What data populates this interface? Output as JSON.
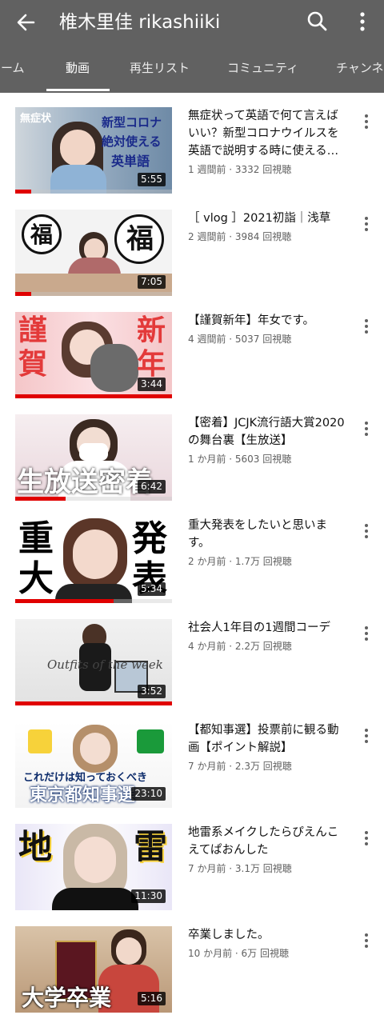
{
  "header": {
    "title": "椎木里佳 rikashiiki",
    "back_icon": "arrow-left-icon",
    "search_icon": "search-icon",
    "more_icon": "more-vert-icon"
  },
  "tabs": [
    {
      "label": "ホーム"
    },
    {
      "label": "動画"
    },
    {
      "label": "再生リスト"
    },
    {
      "label": "コミュニティ"
    },
    {
      "label": "チャンネル"
    }
  ],
  "active_tab": "動画",
  "videos": [
    {
      "title": "無症状って英語で何て言えばいい？新型コロナウイルスを英語で説明する時に使える…",
      "meta": "1 週間前 · 3332 回視聴",
      "duration": "5:55",
      "progress": 0.1,
      "thumb_texts": [
        "無症状",
        "新型コロナ",
        "絶対使える",
        "英単語"
      ]
    },
    {
      "title": "［ vlog ］2021初詣｜浅草",
      "meta": "2 週間前 · 3984 回視聴",
      "duration": "7:05",
      "progress": 0.1,
      "thumb_texts": [
        "福",
        "福"
      ]
    },
    {
      "title": "【謹賀新年】年女です。",
      "meta": "4 週間前 · 5037 回視聴",
      "duration": "3:44",
      "progress": 1.0,
      "thumb_texts": [
        "謹",
        "賀",
        "新",
        "年"
      ]
    },
    {
      "title": "【密着】JCJK流行語大賞2020の舞台裏【生放送】",
      "meta": "1 か月前 · 5603 回視聴",
      "duration": "6:42",
      "progress": 0.32,
      "thumb_texts": [
        "生放送密着"
      ]
    },
    {
      "title": "重大発表をしたいと思います。",
      "meta": "2 か月前 · 1.7万 回視聴",
      "duration": "5:34",
      "progress": 0.63,
      "thumb_texts": [
        "重",
        "大",
        "発",
        "表"
      ]
    },
    {
      "title": "社会人1年目の1週間コーデ",
      "meta": "4 か月前 · 2.2万 回視聴",
      "duration": "3:52",
      "progress": 1.0,
      "thumb_texts": [
        "Outfits of the week"
      ]
    },
    {
      "title": "【都知事選】投票前に観る動画【ポイント解説】",
      "meta": "7 か月前 · 2.3万 回視聴",
      "duration": "23:10",
      "progress": 0,
      "thumb_texts": [
        "これだけは知っておくべき",
        "東京都知事選"
      ]
    },
    {
      "title": "地雷系メイクしたらぴえんこえてぱおんした",
      "meta": "7 か月前 · 3.1万 回視聴",
      "duration": "11:30",
      "progress": 0,
      "thumb_texts": [
        "地",
        "雷"
      ]
    },
    {
      "title": "卒業しました。",
      "meta": "10 か月前 · 6万 回視聴",
      "duration": "5:16",
      "progress": 0,
      "thumb_texts": [
        "大学卒業"
      ]
    }
  ],
  "colors": {
    "appbar": "#616161",
    "progress": "#e00000",
    "meta_text": "#606060"
  }
}
